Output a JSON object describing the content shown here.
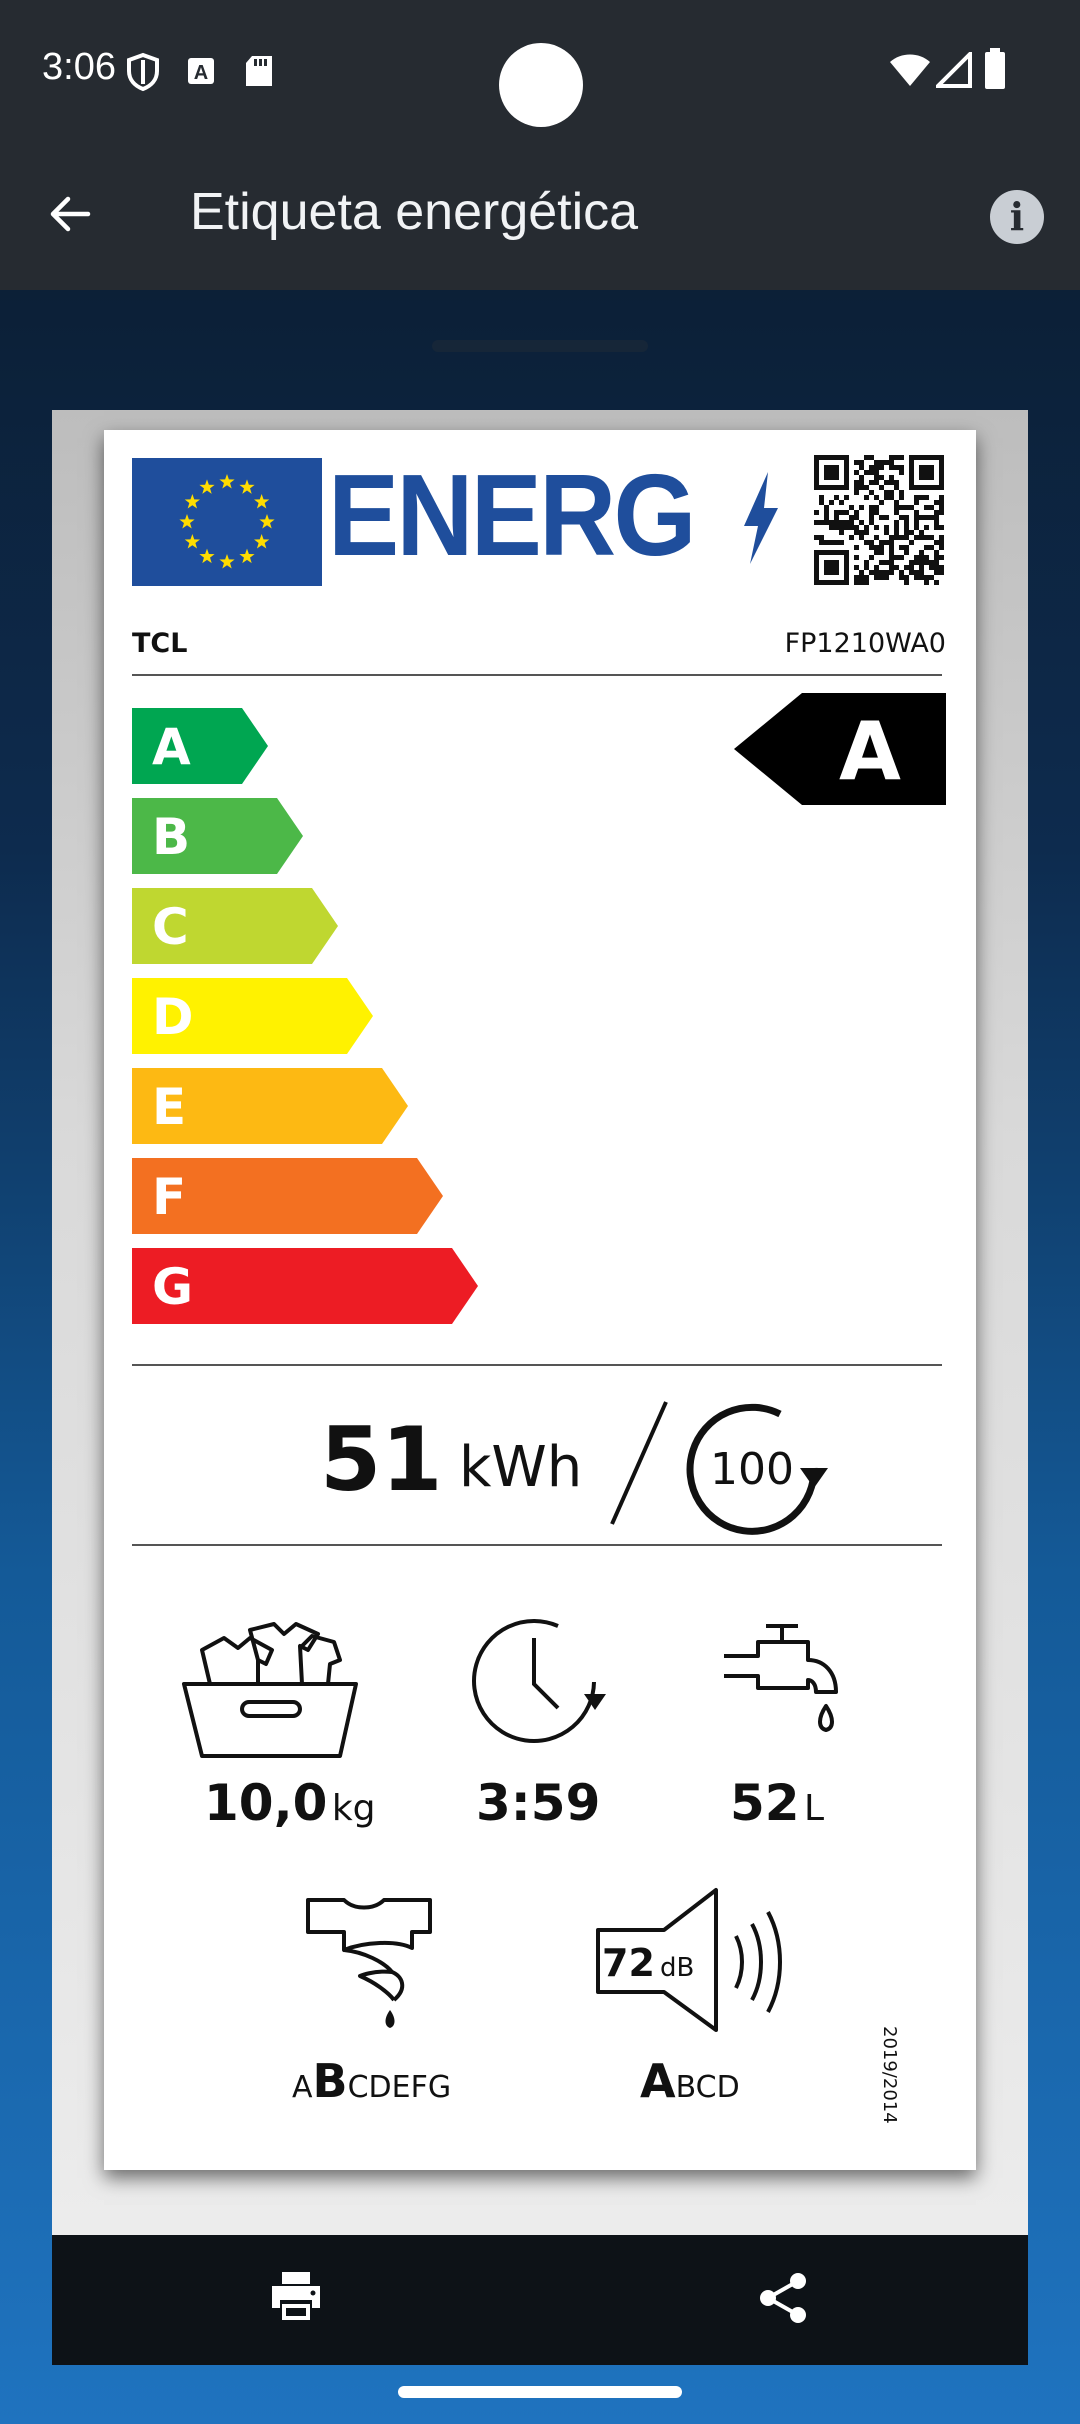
{
  "status_bar": {
    "time": "3:06"
  },
  "app_bar": {
    "title": "Etiqueta energética"
  },
  "label": {
    "energy_word": "ENERG",
    "brand": "TCL",
    "model": "FP1210WA0",
    "efficiency_classes": [
      "A",
      "B",
      "C",
      "D",
      "E",
      "F",
      "G"
    ],
    "class_colors": [
      "#00a651",
      "#4cb848",
      "#bfd730",
      "#fff200",
      "#fdb913",
      "#f37021",
      "#ed1c24"
    ],
    "rated_class": "A",
    "energy_value": "51",
    "energy_unit": "kWh",
    "cycles": "100",
    "capacity_value": "10,0",
    "capacity_unit": "kg",
    "duration": "3:59",
    "water_value": "52",
    "water_unit": "L",
    "spin_class_first": "A",
    "spin_class_selected": "B",
    "spin_class_rest": "CDEFG",
    "noise_value": "72",
    "noise_unit": "dB",
    "noise_class_selected": "A",
    "noise_class_rest": "BCD",
    "regulation": "2019/2014"
  },
  "bottom_bar": {
    "icons": [
      "print-icon",
      "share-icon"
    ]
  }
}
